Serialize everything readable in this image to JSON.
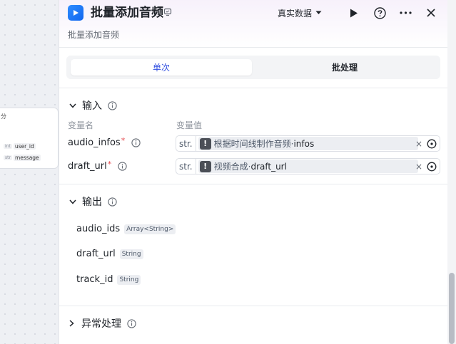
{
  "canvas_node": {
    "title_fragment": "分",
    "rows": [
      {
        "type": "int",
        "name": "user_id"
      },
      {
        "type": "str",
        "name": "message"
      }
    ]
  },
  "header": {
    "title": "批量添加音频",
    "subtitle": "批量添加音频",
    "data_mode": "真实数据",
    "icons": [
      "app-logo-icon",
      "edit-icon",
      "chevron-down-icon",
      "play-icon",
      "help-icon",
      "more-icon",
      "close-icon"
    ]
  },
  "tabs": [
    {
      "label": "单次",
      "active": true
    },
    {
      "label": "批处理",
      "active": false
    }
  ],
  "inputs": {
    "title": "输入",
    "col_name": "变量名",
    "col_value": "变量值",
    "rows": [
      {
        "name": "audio_infos",
        "required": "*",
        "type_tag": "str.",
        "ref_node": "根据时间线制作音频",
        "sep": " · ",
        "ref_var": "infos"
      },
      {
        "name": "draft_url",
        "required": "*",
        "type_tag": "str.",
        "ref_node": "视频合成",
        "sep": " · ",
        "ref_var": "draft_url"
      }
    ]
  },
  "outputs": {
    "title": "输出",
    "rows": [
      {
        "name": "audio_ids",
        "type": "Array<String>"
      },
      {
        "name": "draft_url",
        "type": "String"
      },
      {
        "name": "track_id",
        "type": "String"
      }
    ]
  },
  "exception": {
    "title": "异常处理"
  },
  "colors": {
    "accent": "#3250e0",
    "required": "#e5484d",
    "logo": "#1a73f0"
  }
}
